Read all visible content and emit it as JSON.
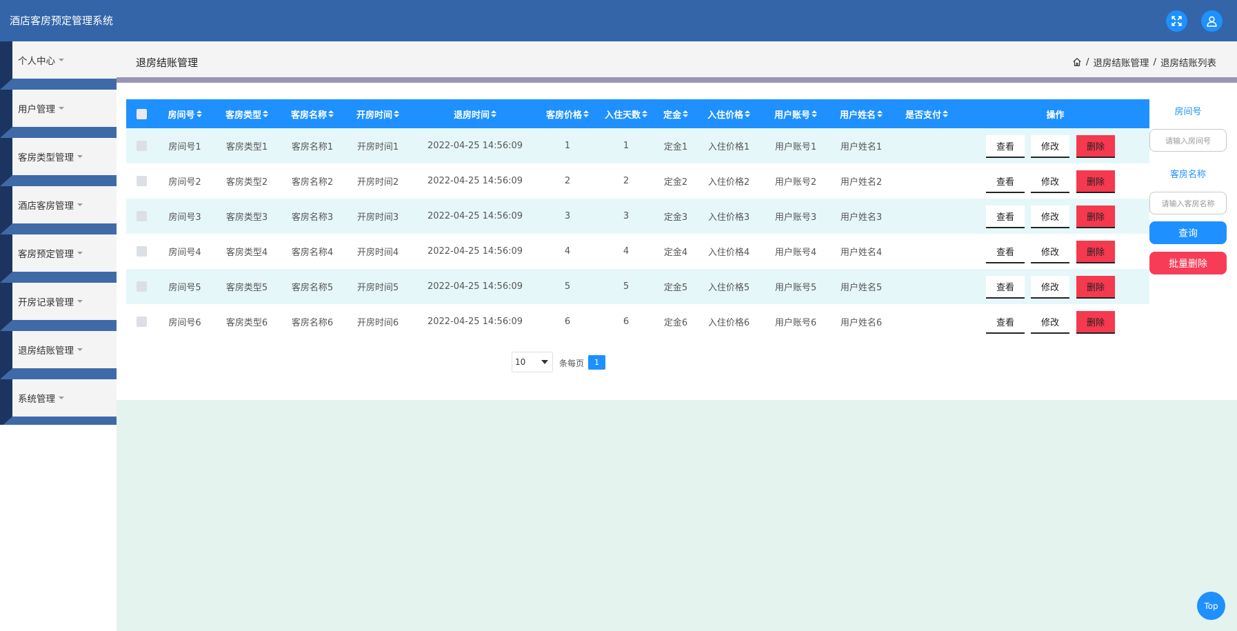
{
  "app": {
    "title": "酒店客房预定管理系统"
  },
  "sidebar": {
    "items": [
      {
        "label": "个人中心"
      },
      {
        "label": "用户管理"
      },
      {
        "label": "客房类型管理"
      },
      {
        "label": "酒店客房管理"
      },
      {
        "label": "客房预定管理"
      },
      {
        "label": "开房记录管理"
      },
      {
        "label": "退房结账管理"
      },
      {
        "label": "系统管理"
      }
    ]
  },
  "page": {
    "title": "退房结账管理",
    "breadcrumb": {
      "sep1": "/",
      "level1": "退房结账管理",
      "sep2": "/",
      "level2": "退房结账列表"
    }
  },
  "table": {
    "headers": {
      "room_no": "房间号",
      "room_type": "客房类型",
      "room_name": "客房名称",
      "open_time": "开房时间",
      "checkout_time": "退房时间",
      "price": "客房价格",
      "days": "入住天数",
      "deposit": "定金",
      "stay_price": "入住价格",
      "account": "用户账号",
      "user_name": "用户姓名",
      "paid": "是否支付",
      "actions": "操作"
    },
    "rows": [
      {
        "room_no": "房间号1",
        "room_type": "客房类型1",
        "room_name": "客房名称1",
        "open_time": "开房时间1",
        "checkout_time": "2022-04-25 14:56:09",
        "price": "1",
        "days": "1",
        "deposit": "定金1",
        "stay_price": "入住价格1",
        "account": "用户账号1",
        "user_name": "用户姓名1",
        "paid": ""
      },
      {
        "room_no": "房间号2",
        "room_type": "客房类型2",
        "room_name": "客房名称2",
        "open_time": "开房时间2",
        "checkout_time": "2022-04-25 14:56:09",
        "price": "2",
        "days": "2",
        "deposit": "定金2",
        "stay_price": "入住价格2",
        "account": "用户账号2",
        "user_name": "用户姓名2",
        "paid": ""
      },
      {
        "room_no": "房间号3",
        "room_type": "客房类型3",
        "room_name": "客房名称3",
        "open_time": "开房时间3",
        "checkout_time": "2022-04-25 14:56:09",
        "price": "3",
        "days": "3",
        "deposit": "定金3",
        "stay_price": "入住价格3",
        "account": "用户账号3",
        "user_name": "用户姓名3",
        "paid": ""
      },
      {
        "room_no": "房间号4",
        "room_type": "客房类型4",
        "room_name": "客房名称4",
        "open_time": "开房时间4",
        "checkout_time": "2022-04-25 14:56:09",
        "price": "4",
        "days": "4",
        "deposit": "定金4",
        "stay_price": "入住价格4",
        "account": "用户账号4",
        "user_name": "用户姓名4",
        "paid": ""
      },
      {
        "room_no": "房间号5",
        "room_type": "客房类型5",
        "room_name": "客房名称5",
        "open_time": "开房时间5",
        "checkout_time": "2022-04-25 14:56:09",
        "price": "5",
        "days": "5",
        "deposit": "定金5",
        "stay_price": "入住价格5",
        "account": "用户账号5",
        "user_name": "用户姓名5",
        "paid": ""
      },
      {
        "room_no": "房间号6",
        "room_type": "客房类型6",
        "room_name": "客房名称6",
        "open_time": "开房时间6",
        "checkout_time": "2022-04-25 14:56:09",
        "price": "6",
        "days": "6",
        "deposit": "定金6",
        "stay_price": "入住价格6",
        "account": "用户账号6",
        "user_name": "用户姓名6",
        "paid": ""
      }
    ],
    "actions": {
      "view": "查看",
      "edit": "修改",
      "delete": "删除"
    }
  },
  "pagination": {
    "page_size": "10",
    "per_page_text": "条每页",
    "current_page": "1"
  },
  "search": {
    "room_no_label": "房间号",
    "room_no_placeholder": "请输入房间号",
    "room_name_label": "客房名称",
    "room_name_placeholder": "请输入客房名称",
    "search_button": "查询",
    "batch_delete_button": "批量删除"
  },
  "top_button": "Top",
  "colors": {
    "header": "#3465a8",
    "primary": "#1e90ff",
    "danger": "#f5394f",
    "row_stripe": "#e6f7f9"
  }
}
